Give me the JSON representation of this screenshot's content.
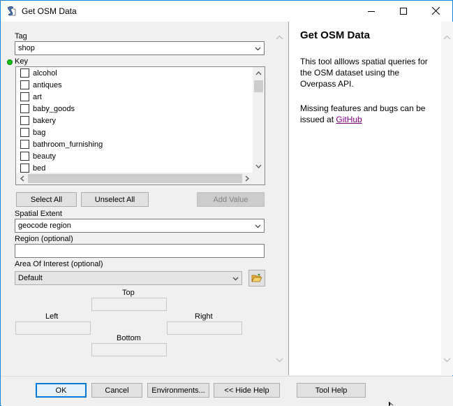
{
  "window": {
    "title": "Get OSM Data",
    "icon": "python-script-icon"
  },
  "form": {
    "tag_label": "Tag",
    "tag_value": "shop",
    "key_label": "Key",
    "key_items": [
      {
        "label": "alcohol",
        "checked": false
      },
      {
        "label": "antiques",
        "checked": false
      },
      {
        "label": "art",
        "checked": false
      },
      {
        "label": "baby_goods",
        "checked": false
      },
      {
        "label": "bakery",
        "checked": false
      },
      {
        "label": "bag",
        "checked": false
      },
      {
        "label": "bathroom_furnishing",
        "checked": false
      },
      {
        "label": "beauty",
        "checked": false
      },
      {
        "label": "bed",
        "checked": false
      }
    ],
    "select_all": "Select All",
    "unselect_all": "Unselect All",
    "add_value": "Add Value",
    "spatial_extent_label": "Spatial Extent",
    "spatial_extent_value": "geocode region",
    "region_label": "Region (optional)",
    "region_value": "",
    "aoi_label": "Area Of Interest (optional)",
    "aoi_value": "Default",
    "top_label": "Top",
    "left_label": "Left",
    "right_label": "Right",
    "bottom_label": "Bottom"
  },
  "help": {
    "title": "Get OSM Data",
    "paragraph1": "This tool alllows spatial queries for the OSM dataset using the Overpass API.",
    "paragraph2_prefix": "Missing features and bugs can be issued at ",
    "link_text": "GitHub"
  },
  "buttons": {
    "ok": "OK",
    "cancel": "Cancel",
    "environments": "Environments...",
    "hide_help": "<< Hide Help",
    "tool_help": "Tool Help"
  },
  "colors": {
    "window_border": "#1883d7",
    "default_button_border": "#0078d7",
    "link": "#800080",
    "valid_indicator": "#10c010"
  }
}
